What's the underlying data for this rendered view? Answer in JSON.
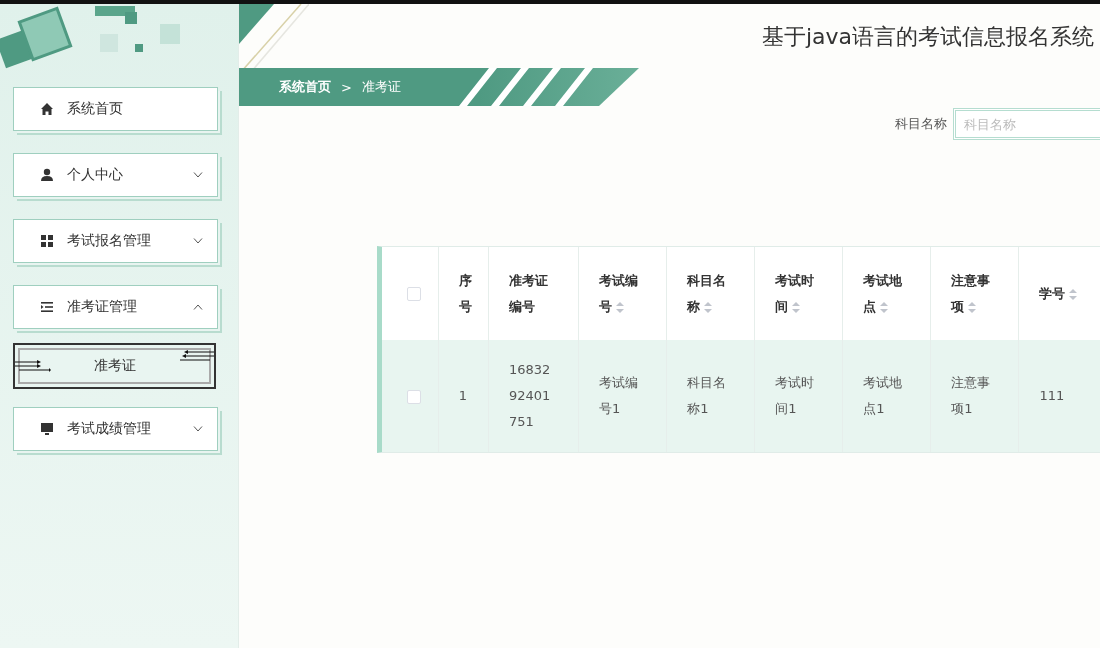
{
  "title": "基于java语言的考试信息报名系统",
  "sidebar": {
    "items": [
      {
        "label": "系统首页"
      },
      {
        "label": "个人中心",
        "expanded": false
      },
      {
        "label": "考试报名管理",
        "expanded": false
      },
      {
        "label": "准考证管理",
        "expanded": true,
        "children": [
          {
            "label": "准考证",
            "selected": true
          }
        ]
      },
      {
        "label": "考试成绩管理",
        "expanded": false
      }
    ]
  },
  "breadcrumb": [
    "系统首页",
    ">",
    "准考证"
  ],
  "search": {
    "label": "科目名称",
    "placeholder": "科目名称"
  },
  "table": {
    "header_checked": false,
    "columns": [
      "序号",
      "准考证编号",
      "考试编号",
      "科目名称",
      "考试时间",
      "考试地点",
      "注意事项",
      "学号"
    ],
    "rows": [
      {
        "checked": false,
        "cells": [
          "1",
          "1683292401751",
          "考试编号1",
          "科目名称1",
          "考试时间1",
          "考试地点1",
          "注意事项1",
          "111"
        ]
      }
    ]
  }
}
